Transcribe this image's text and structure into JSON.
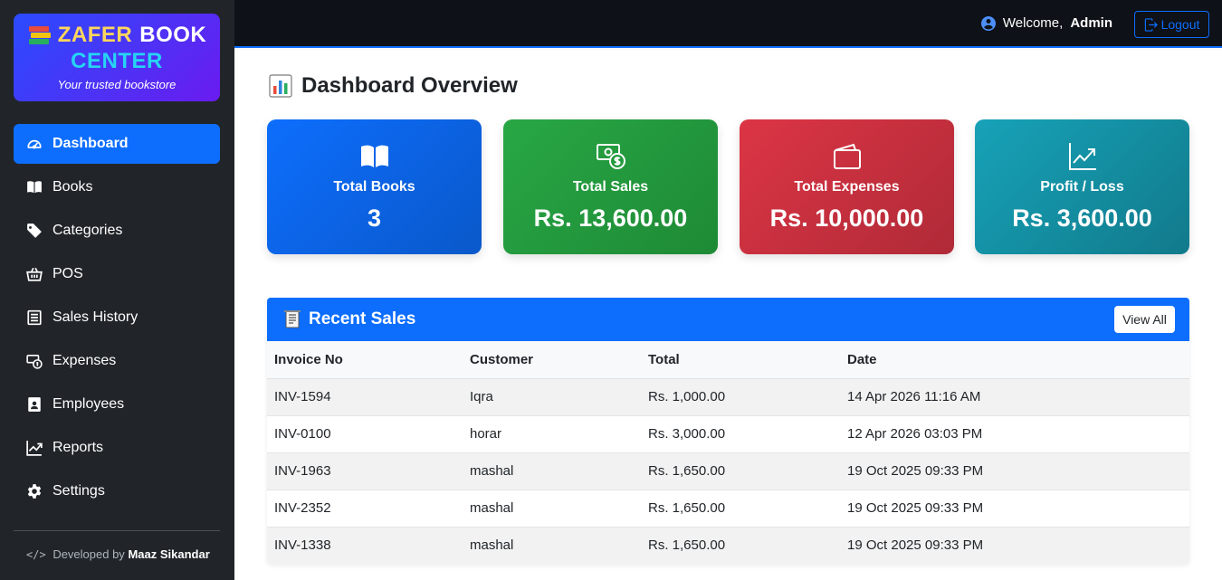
{
  "brand": {
    "title_word1": "ZAFER",
    "title_word2": "BOOK",
    "title_word3": "CENTER",
    "tagline": "Your trusted bookstore"
  },
  "sidebar": {
    "items": [
      {
        "label": "Dashboard",
        "icon": "speedometer-icon",
        "active": true
      },
      {
        "label": "Books",
        "icon": "book-icon"
      },
      {
        "label": "Categories",
        "icon": "tags-icon"
      },
      {
        "label": "POS",
        "icon": "basket-icon"
      },
      {
        "label": "Sales History",
        "icon": "receipt-icon"
      },
      {
        "label": "Expenses",
        "icon": "cash-coin-icon"
      },
      {
        "label": "Employees",
        "icon": "person-badge-icon"
      },
      {
        "label": "Reports",
        "icon": "graph-up-icon"
      },
      {
        "label": "Settings",
        "icon": "gear-icon"
      }
    ],
    "footer": {
      "prefix": "Developed by",
      "author": "Maaz Sikandar"
    }
  },
  "topbar": {
    "welcome_prefix": "Welcome,",
    "user": "Admin",
    "logout_label": "Logout"
  },
  "page": {
    "title": "Dashboard Overview"
  },
  "cards": [
    {
      "label": "Total Books",
      "value": "3",
      "color": "#0d6efd",
      "icon": "book-open-icon"
    },
    {
      "label": "Total Sales",
      "value": "Rs. 13,600.00",
      "color": "#28a745",
      "icon": "cash-coin-icon"
    },
    {
      "label": "Total Expenses",
      "value": "Rs. 10,000.00",
      "color": "#dc3545",
      "icon": "wallet-icon"
    },
    {
      "label": "Profit / Loss",
      "value": "Rs. 3,600.00",
      "color": "#17a2b8",
      "icon": "graph-up-icon"
    }
  ],
  "recent_sales": {
    "title": "Recent Sales",
    "view_all_label": "View All",
    "columns": [
      "Invoice No",
      "Customer",
      "Total",
      "Date"
    ],
    "rows": [
      [
        "INV-1594",
        "Iqra",
        "Rs. 1,000.00",
        "14 Apr 2026 11:16 AM"
      ],
      [
        "INV-0100",
        "horar",
        "Rs. 3,000.00",
        "12 Apr 2026 03:03 PM"
      ],
      [
        "INV-1963",
        "mashal",
        "Rs. 1,650.00",
        "19 Oct 2025 09:33 PM"
      ],
      [
        "INV-2352",
        "mashal",
        "Rs. 1,650.00",
        "19 Oct 2025 09:33 PM"
      ],
      [
        "INV-1338",
        "mashal",
        "Rs. 1,650.00",
        "19 Oct 2025 09:33 PM"
      ]
    ]
  },
  "colors": {
    "primary": "#0d6efd",
    "sidebar_bg": "#212529",
    "topbar_bg": "#0e1117"
  }
}
